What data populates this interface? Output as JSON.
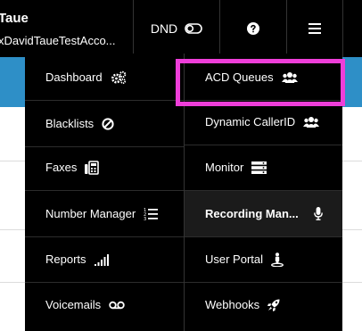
{
  "header": {
    "user_name": "Taue",
    "account": "xDavidTaueTestAcco...",
    "dnd_label": "DND"
  },
  "menu": {
    "left": [
      {
        "label": "Dashboard",
        "icon": "cogs-icon"
      },
      {
        "label": "Blacklists",
        "icon": "ban-icon"
      },
      {
        "label": "Faxes",
        "icon": "fax-icon"
      },
      {
        "label": "Number Manager",
        "icon": "list-numbered-icon"
      },
      {
        "label": "Reports",
        "icon": "signal-bars-icon"
      },
      {
        "label": "Voicemails",
        "icon": "voicemail-icon"
      }
    ],
    "right": [
      {
        "label": "ACD Queues",
        "icon": "users-icon",
        "highlighted": true
      },
      {
        "label": "Dynamic CallerID",
        "icon": "users-icon"
      },
      {
        "label": "Monitor",
        "icon": "server-icon"
      },
      {
        "label": "Recording Man...",
        "icon": "microphone-icon",
        "active": true
      },
      {
        "label": "User Portal",
        "icon": "street-view-icon"
      },
      {
        "label": "Webhooks",
        "icon": "rocket-icon"
      }
    ]
  },
  "colors": {
    "highlight": "#ee3ed9",
    "accent_blue": "#2e8fc7"
  }
}
